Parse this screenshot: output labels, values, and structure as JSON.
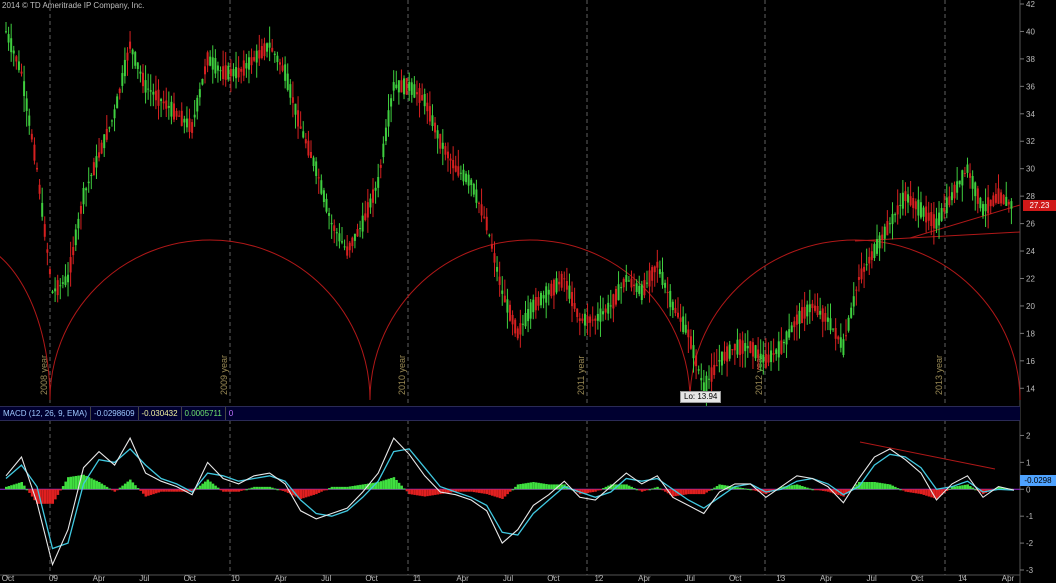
{
  "copyright": "2014 © TD Ameritrade IP Company, Inc.",
  "price_flag": "27.23",
  "lo_label": "Lo: 13.94",
  "macd_header": {
    "title": "MACD (12, 26, 9, EMA)",
    "value": "-0.0298609",
    "avg": "-0.030432",
    "diff": "0.0005711",
    "extra": "0"
  },
  "macd_flag": "-0.0298",
  "colors": {
    "up_candle": "#3fcf3f",
    "down_candle": "#d62020",
    "cycle_arc": "#b01818",
    "macd_line": "#e8e8e8",
    "signal_line": "#40c8e0",
    "hist_up": "#40e040",
    "hist_down": "#e02020",
    "cycle_line": "#606060"
  },
  "chart_data": {
    "type": "line",
    "series": [
      {
        "name": "",
        "x": [
          "2008-10",
          "2008-11",
          "2008-12",
          "2009-01",
          "2009-02",
          "2009-03",
          "2009-04",
          "2009-05",
          "2009-06",
          "2009-07",
          "2009-08",
          "2009-09",
          "2009-10",
          "2009-11",
          "2009-12",
          "2010-01",
          "2010-02",
          "2010-03",
          "2010-04",
          "2010-05",
          "2010-06",
          "2010-07",
          "2010-08",
          "2010-09",
          "2010-10",
          "2010-11",
          "2010-12",
          "2011-01",
          "2011-02",
          "2011-03",
          "2011-04",
          "2011-05",
          "2011-06",
          "2011-07",
          "2011-08",
          "2011-09",
          "2011-10",
          "2011-11",
          "2011-12",
          "2012-01",
          "2012-02",
          "2012-03",
          "2012-04",
          "2012-05",
          "2012-06",
          "2012-07",
          "2012-08",
          "2012-09",
          "2012-10",
          "2012-11",
          "2012-12",
          "2013-01",
          "2013-02",
          "2013-03",
          "2013-04",
          "2013-05",
          "2013-06",
          "2013-07",
          "2013-08",
          "2013-09",
          "2013-10",
          "2013-11",
          "2013-12",
          "2014-01",
          "2014-02",
          "2014-03"
        ],
        "y": [
          40,
          37,
          30,
          21,
          22,
          28,
          31,
          34,
          39,
          36,
          35,
          34,
          33,
          38,
          37,
          37,
          38,
          39,
          37,
          33,
          30,
          26,
          24,
          26,
          29,
          36,
          36,
          35,
          32,
          30,
          29,
          26,
          21,
          18,
          20,
          21,
          22,
          19,
          19,
          20,
          22,
          21,
          23,
          20,
          18,
          14,
          16,
          17,
          17,
          16,
          17,
          19,
          20,
          19,
          17,
          22,
          24,
          26,
          28,
          27,
          26,
          28,
          30,
          27,
          28,
          27.23
        ]
      }
    ],
    "y_axis": {
      "min": 13,
      "max": 42,
      "ticks": [
        14,
        16,
        18,
        20,
        22,
        24,
        26,
        28,
        30,
        32,
        34,
        36,
        38,
        40,
        42
      ]
    },
    "x_tick_labels": [
      "Oct",
      "09",
      "Apr",
      "Jul",
      "Oct",
      "10",
      "Apr",
      "Jul",
      "Oct",
      "11",
      "Apr",
      "Jul",
      "Oct",
      "12",
      "Apr",
      "Jul",
      "Oct",
      "13",
      "Apr",
      "Jul",
      "Oct",
      "14",
      "Apr"
    ],
    "cycle_labels": [
      "2008 year",
      "2009 year",
      "2010 year",
      "2011 year",
      "2012 year",
      "2013 year"
    ],
    "low": 13.94,
    "last": 27.23,
    "grid": false,
    "macd": {
      "y_axis": {
        "min": -3,
        "max": 2.5,
        "ticks": [
          2,
          1,
          0,
          -1,
          -2,
          -3
        ]
      },
      "macd": [
        0.5,
        1.2,
        -0.5,
        -2.8,
        -1.5,
        0.8,
        1.4,
        0.9,
        1.9,
        0.6,
        0.3,
        0.1,
        -0.2,
        1.0,
        0.4,
        0.2,
        0.5,
        0.6,
        0.2,
        -0.8,
        -1.1,
        -0.9,
        -0.7,
        -0.1,
        0.6,
        1.9,
        1.3,
        0.5,
        -0.1,
        -0.2,
        -0.4,
        -0.8,
        -2.0,
        -1.5,
        -0.6,
        -0.2,
        0.3,
        -0.3,
        -0.4,
        0.1,
        0.6,
        0.2,
        0.5,
        -0.3,
        -0.6,
        -0.9,
        -0.1,
        0.2,
        0.2,
        -0.3,
        0.1,
        0.5,
        0.4,
        0.1,
        -0.5,
        0.4,
        1.2,
        1.5,
        1.1,
        0.6,
        -0.4,
        0.2,
        0.5,
        -0.3,
        0.1,
        -0.03
      ],
      "signal": [
        0.4,
        0.9,
        0.1,
        -2.2,
        -2.0,
        0.2,
        1.1,
        1.0,
        1.5,
        0.9,
        0.4,
        0.2,
        -0.1,
        0.6,
        0.5,
        0.3,
        0.4,
        0.5,
        0.3,
        -0.4,
        -0.9,
        -1.0,
        -0.8,
        -0.3,
        0.3,
        1.4,
        1.5,
        0.8,
        0.1,
        -0.1,
        -0.3,
        -0.6,
        -1.6,
        -1.7,
        -0.9,
        -0.4,
        0.1,
        -0.1,
        -0.3,
        -0.1,
        0.4,
        0.3,
        0.4,
        0.0,
        -0.4,
        -0.7,
        -0.3,
        0.1,
        0.2,
        -0.1,
        0.0,
        0.3,
        0.4,
        0.2,
        -0.2,
        0.1,
        0.9,
        1.3,
        1.2,
        0.8,
        0.0,
        0.1,
        0.3,
        -0.1,
        0.0,
        -0.03
      ]
    }
  }
}
